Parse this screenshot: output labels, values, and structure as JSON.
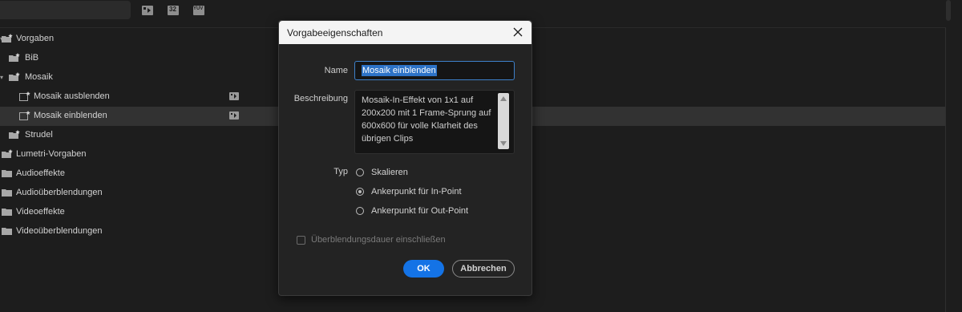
{
  "toolbar": {
    "icons": [
      "new-custom-bin-icon",
      "32-bit-filter-icon",
      "yuv-filter-icon"
    ],
    "yuv_label": "YUV",
    "icon_32_label": "32"
  },
  "tree": {
    "items": [
      {
        "label": "Vorgaben",
        "icon": "preset-folder-icon"
      },
      {
        "label": "BiB",
        "icon": "preset-folder-icon"
      },
      {
        "label": "Mosaik",
        "icon": "preset-folder-icon"
      },
      {
        "label": "Mosaik ausblenden",
        "icon": "preset-icon"
      },
      {
        "label": "Mosaik einblenden",
        "icon": "preset-icon"
      },
      {
        "label": "Strudel",
        "icon": "preset-folder-icon"
      },
      {
        "label": "Lumetri-Vorgaben",
        "icon": "preset-folder-icon"
      },
      {
        "label": "Audioeffekte",
        "icon": "folder-icon"
      },
      {
        "label": "Audioüberblendungen",
        "icon": "folder-icon"
      },
      {
        "label": "Videoeffekte",
        "icon": "folder-icon"
      },
      {
        "label": "Videoüberblendungen",
        "icon": "folder-icon"
      }
    ]
  },
  "dialog": {
    "title": "Vorgabeeigenschaften",
    "name_label": "Name",
    "name_value": "Mosaik einblenden",
    "description_label": "Beschreibung",
    "description_value": "Mosaik-In-Effekt von 1x1 auf 200x200 mit 1 Frame-Sprung auf 600x600 für volle Klarheit des übrigen Clips",
    "type_label": "Typ",
    "type_options": [
      "Skalieren",
      "Ankerpunkt für In-Point",
      "Ankerpunkt für Out-Point"
    ],
    "type_selected": "Ankerpunkt für In-Point",
    "checkbox_label": "Überblendungsdauer einschließen",
    "checkbox_checked": false,
    "ok_label": "OK",
    "cancel_label": "Abbrechen"
  },
  "colors": {
    "accent": "#1473e6",
    "background": "#1d1d1d",
    "dialog_bg": "#232323",
    "selection_row": "#323232"
  }
}
